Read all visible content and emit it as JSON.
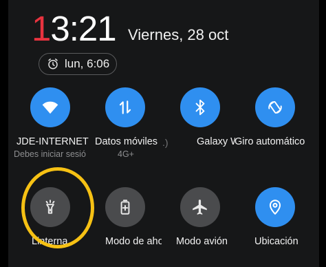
{
  "header": {
    "time_first": "1",
    "time_rest": "3:21",
    "date": "Viernes, 28 oct"
  },
  "alarm": {
    "icon": "alarm-clock-icon",
    "text": "lun, 6:06"
  },
  "tiles": [
    {
      "icon": "wifi-icon",
      "label": "JDE-INTERNET",
      "sub": "Debes iniciar sesió",
      "active": true
    },
    {
      "icon": "mobile-data-icon",
      "label": "Datos móviles",
      "sub": "4G+",
      "active": true
    },
    {
      "icon": "bluetooth-icon",
      "label": "Galaxy W",
      "sub": "",
      "active": true
    },
    {
      "icon": "auto-rotate-icon",
      "label": "Giro automático",
      "sub": "",
      "active": true
    },
    {
      "icon": "flashlight-icon",
      "label": "Linterna",
      "sub": "",
      "active": false
    },
    {
      "icon": "battery-saver-icon",
      "label": "Modo de aho",
      "sub": "",
      "active": false
    },
    {
      "icon": "airplane-icon",
      "label": "Modo avión",
      "sub": "",
      "active": false
    },
    {
      "icon": "location-icon",
      "label": "Ubicación",
      "sub": "",
      "active": true
    }
  ],
  "fragment": ".)",
  "colors": {
    "accent": "#2f8ff0",
    "inactive": "#4a4b4d",
    "highlight": "#f6c114",
    "clock_red": "#e8333f"
  }
}
